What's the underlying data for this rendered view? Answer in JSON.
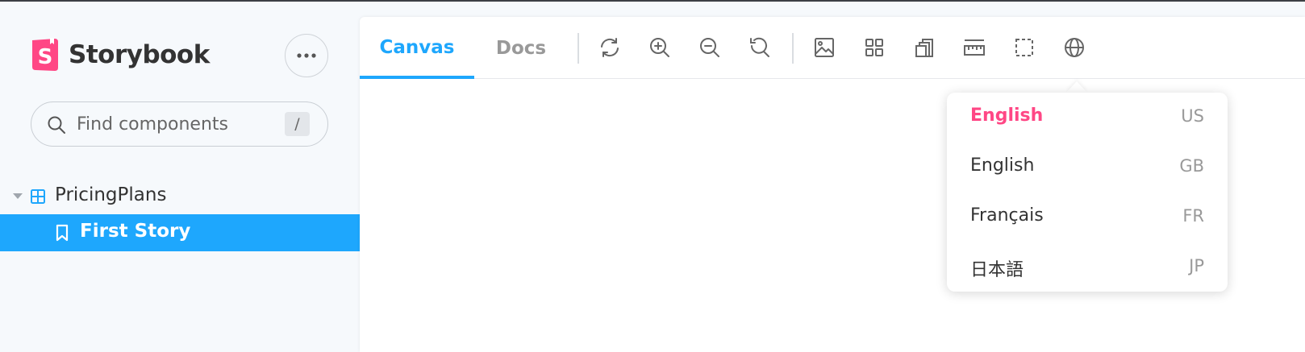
{
  "app": {
    "name": "Storybook"
  },
  "colors": {
    "accent": "#1ea7fd",
    "brand": "#ff4785",
    "sidebar_bg": "#f6f9fc"
  },
  "sidebar": {
    "search_placeholder": "Find components",
    "search_shortcut": "/",
    "tree": [
      {
        "type": "component",
        "label": "PricingPlans",
        "expanded": true,
        "children": [
          {
            "type": "story",
            "label": "First Story",
            "selected": true
          }
        ]
      }
    ]
  },
  "toolbar": {
    "tabs": [
      {
        "label": "Canvas",
        "active": true
      },
      {
        "label": "Docs",
        "active": false
      }
    ],
    "tools": [
      {
        "icon": "sync-icon"
      },
      {
        "icon": "zoom-in-icon"
      },
      {
        "icon": "zoom-out-icon"
      },
      {
        "icon": "zoom-reset-icon"
      },
      {
        "icon": "background-icon"
      },
      {
        "icon": "grid-icon"
      },
      {
        "icon": "viewport-icon"
      },
      {
        "icon": "measure-icon"
      },
      {
        "icon": "outline-icon"
      },
      {
        "icon": "globe-icon"
      }
    ]
  },
  "locale_menu": {
    "options": [
      {
        "label": "English",
        "code": "US",
        "selected": true
      },
      {
        "label": "English",
        "code": "GB",
        "selected": false
      },
      {
        "label": "Français",
        "code": "FR",
        "selected": false
      },
      {
        "label": "日本語",
        "code": "JP",
        "selected": false
      }
    ]
  }
}
